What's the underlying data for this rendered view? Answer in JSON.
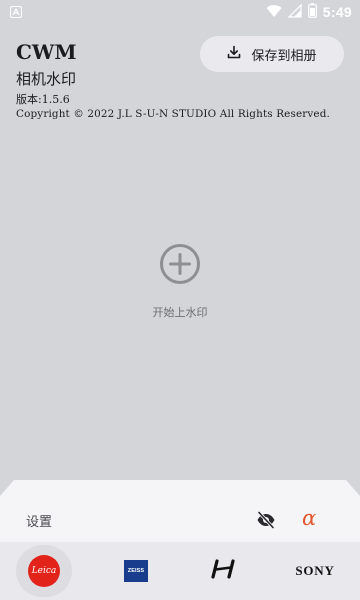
{
  "status_bar": {
    "time": "5:49",
    "icons": [
      "notification-a-icon",
      "wifi-icon",
      "cellular-signal-icon",
      "battery-icon"
    ]
  },
  "header": {
    "title": "CWM",
    "subtitle": "相机水印",
    "version": "版本:1.5.6",
    "copyright": "Copyright © 2022 J.L S-U-N STUDIO All Rights Reserved."
  },
  "toolbar": {
    "save_label": "保存到相册",
    "save_icon": "download-icon"
  },
  "main": {
    "add_icon": "plus-circle-icon",
    "add_label": "开始上水印"
  },
  "settings": {
    "label": "设置",
    "visibility_icon": "eye-off-icon",
    "brand_glyph": "α"
  },
  "brands": {
    "items": [
      {
        "name": "leica",
        "text": "Leica",
        "selected": true
      },
      {
        "name": "zeiss",
        "text": "ZEISS",
        "selected": false
      },
      {
        "name": "hasselblad",
        "text": "H",
        "selected": false
      },
      {
        "name": "sony",
        "text": "SONY",
        "selected": false
      }
    ]
  },
  "colors": {
    "background": "#d3d5d9",
    "panel": "#f5f5f7",
    "brand_bar": "#e8e8ed",
    "accent_alpha": "#e0562e",
    "leica_red": "#e2231a",
    "zeiss_blue": "#1a3c8c"
  }
}
